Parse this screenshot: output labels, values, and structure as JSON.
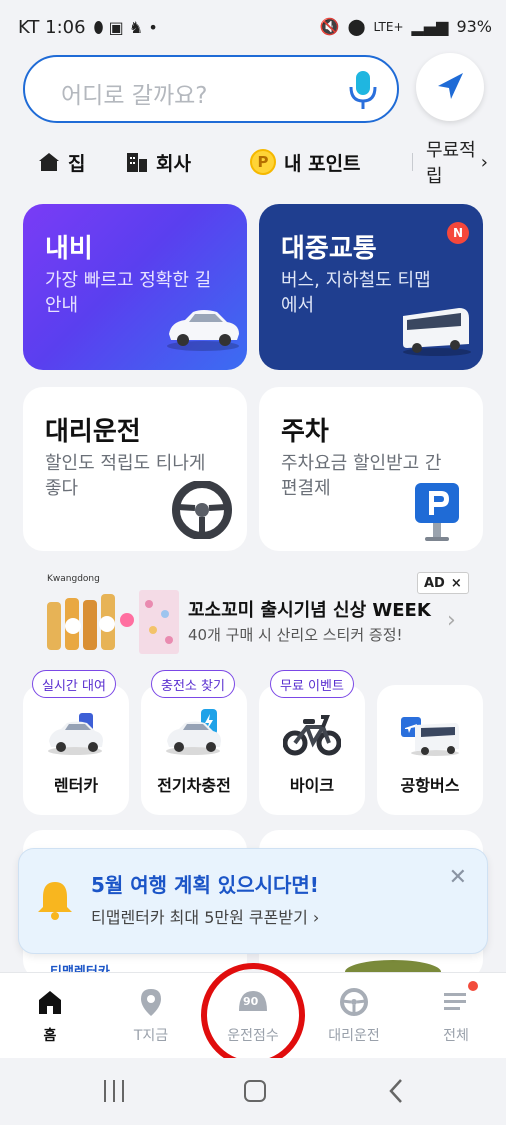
{
  "status_bar": {
    "carrier_time": "KT 1:06",
    "battery": "93%",
    "network": "LTE+"
  },
  "search": {
    "placeholder": "어디로 갈까요?"
  },
  "quick_links": {
    "home": "집",
    "work": "회사",
    "points_icon": "P",
    "points": "내 포인트",
    "free_earn": "무료적립"
  },
  "cards": {
    "navigation": {
      "title": "내비",
      "subtitle": "가장 빠르고 정확한 길안내"
    },
    "transit": {
      "title": "대중교통",
      "subtitle": "버스, 지하철도 티맵에서",
      "badge": "N"
    },
    "driver": {
      "title": "대리운전",
      "subtitle": "할인도 적립도 티나게 좋다"
    },
    "parking": {
      "title": "주차",
      "subtitle": "주차요금 할인받고 간편결제"
    }
  },
  "ad": {
    "brand": "Kwangdong",
    "title": "꼬소꼬미 출시기념 신상 WEEK",
    "subtitle": "40개 구매 시 산리오 스티커 증정!",
    "tag": "AD",
    "close": "×"
  },
  "services": [
    {
      "pill": "실시간 대여",
      "label": "렌터카"
    },
    {
      "pill": "충전소 찾기",
      "label": "전기차충전"
    },
    {
      "pill": "무료 이벤트",
      "label": "바이크"
    },
    {
      "pill": "",
      "label": "공항버스"
    }
  ],
  "promo": {
    "title": "5월 여행 계획 있으시다면!",
    "subtitle": "티맵렌터카 최대 5만원 쿠폰받기 ›",
    "peek_text": "티맵렌터카 …"
  },
  "bottom_nav": {
    "items": [
      {
        "label": "홈"
      },
      {
        "label": "T지금"
      },
      {
        "label": "운전점수",
        "gauge": "90"
      },
      {
        "label": "대리운전"
      },
      {
        "label": "전체"
      }
    ]
  },
  "colors": {
    "accent": "#1f6bd6",
    "annotation": "#e00d0d",
    "transit": "#1f3e8f"
  }
}
